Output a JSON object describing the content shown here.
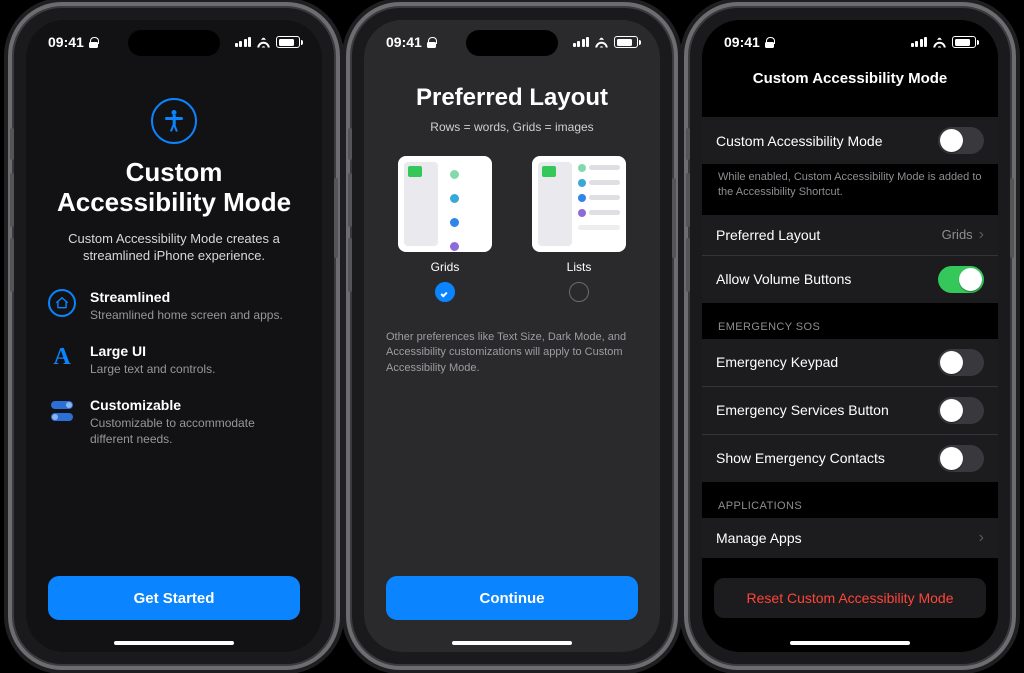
{
  "status": {
    "time": "09:41"
  },
  "screen1": {
    "title": "Custom Accessibility Mode",
    "subtitle": "Custom Accessibility Mode creates a streamlined iPhone experience.",
    "features": [
      {
        "title": "Streamlined",
        "desc": "Streamlined home screen and apps."
      },
      {
        "title": "Large UI",
        "desc": "Large text and controls."
      },
      {
        "title": "Customizable",
        "desc": "Customizable to accommodate different needs."
      }
    ],
    "cta": "Get Started"
  },
  "screen2": {
    "title": "Preferred Layout",
    "subtitle": "Rows = words, Grids = images",
    "options": [
      {
        "label": "Grids",
        "selected": true
      },
      {
        "label": "Lists",
        "selected": false
      }
    ],
    "note": "Other preferences like Text Size, Dark Mode, and Accessibility customizations will apply to Custom Accessibility Mode.",
    "cta": "Continue"
  },
  "screen3": {
    "nav_title": "Custom Accessibility Mode",
    "main_toggle": {
      "label": "Custom Accessibility Mode",
      "on": false
    },
    "main_note": "While enabled, Custom Accessibility Mode is added to the Accessibility Shortcut.",
    "pref_layout": {
      "label": "Preferred Layout",
      "value": "Grids"
    },
    "volume": {
      "label": "Allow Volume Buttons",
      "on": true
    },
    "section_emergency": "EMERGENCY SOS",
    "emergency": [
      {
        "label": "Emergency Keypad",
        "on": false
      },
      {
        "label": "Emergency Services Button",
        "on": false
      },
      {
        "label": "Show Emergency Contacts",
        "on": false
      }
    ],
    "section_apps": "APPLICATIONS",
    "manage_apps": "Manage Apps",
    "reset": "Reset Custom Accessibility Mode"
  }
}
